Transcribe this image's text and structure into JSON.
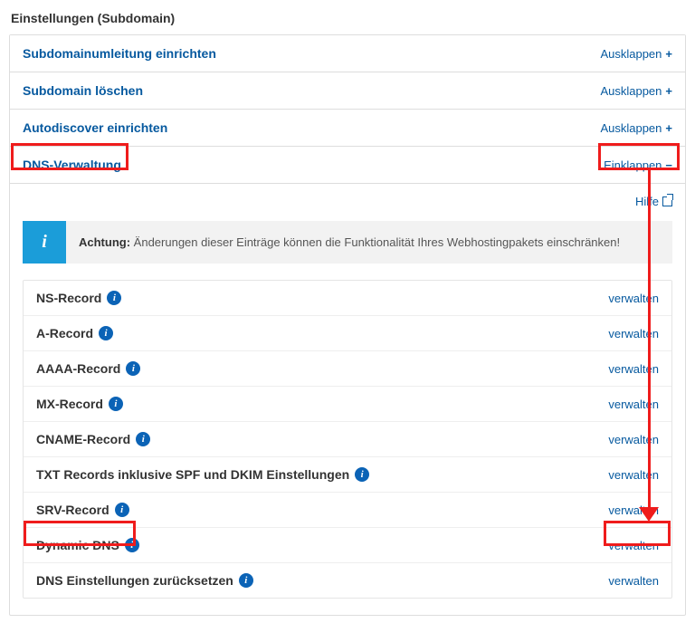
{
  "page_title": "Einstellungen (Subdomain)",
  "toggle": {
    "expand": "Ausklappen",
    "collapse": "Einklappen"
  },
  "help_label": "Hilfe",
  "alert": {
    "prefix": "Achtung:",
    "text": "Änderungen dieser Einträge können die Funktionalität Ihres Webhostingpakets einschränken!"
  },
  "manage_label": "verwalten",
  "sections": {
    "0": {
      "title": "Subdomainumleitung einrichten",
      "expanded": false
    },
    "1": {
      "title": "Subdomain löschen",
      "expanded": false
    },
    "2": {
      "title": "Autodiscover einrichten",
      "expanded": false
    },
    "3": {
      "title": "DNS-Verwaltung",
      "expanded": true
    }
  },
  "records": {
    "0": {
      "name": "NS-Record"
    },
    "1": {
      "name": "A-Record"
    },
    "2": {
      "name": "AAAA-Record"
    },
    "3": {
      "name": "MX-Record"
    },
    "4": {
      "name": "CNAME-Record"
    },
    "5": {
      "name": "TXT Records inklusive SPF und DKIM Einstellungen"
    },
    "6": {
      "name": "SRV-Record"
    },
    "7": {
      "name": "Dynamic DNS"
    },
    "8": {
      "name": "DNS Einstellungen zurücksetzen"
    }
  }
}
